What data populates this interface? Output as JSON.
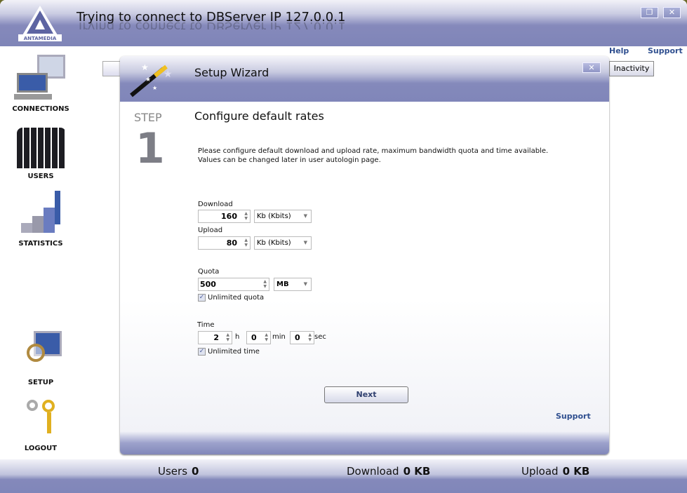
{
  "window": {
    "title": "Trying to connect to DBServer IP 127.0.0.1",
    "logo_text": "ANTAMEDIA",
    "restore_icon": "restore-icon",
    "close_icon": "close-icon"
  },
  "top_links": {
    "help": "Help",
    "support": "Support"
  },
  "sidebar": {
    "items": [
      {
        "label": "CONNECTIONS",
        "icon": "computer-icon"
      },
      {
        "label": "USERS",
        "icon": "users-icon"
      },
      {
        "label": "STATISTICS",
        "icon": "chart-icon"
      },
      {
        "label": "SETUP",
        "icon": "setup-icon"
      },
      {
        "label": "LOGOUT",
        "icon": "keys-icon"
      }
    ]
  },
  "background_tab": {
    "label": "Inactivity"
  },
  "wizard": {
    "title": "Setup Wizard",
    "step_label": "STEP",
    "step_number": "1",
    "heading": "Configure default rates",
    "description_line1": "Please configure default download and upload rate, maximum bandwidth quota  and time available.",
    "description_line2": "Values can be changed later in user autologin page.",
    "download": {
      "label": "Download",
      "value": "160",
      "unit": "Kb (Kbits)"
    },
    "upload": {
      "label": "Upload",
      "value": "80",
      "unit": "Kb (Kbits)"
    },
    "quota": {
      "label": "Quota",
      "value": "500",
      "unit": "MB",
      "unlimited_label": "Unlimited quota",
      "unlimited_checked": true
    },
    "time": {
      "label": "Time",
      "hours": "2",
      "h": "h",
      "minutes": "0",
      "min": "min",
      "seconds": "0",
      "sec": "sec",
      "unlimited_label": "Unlimited time",
      "unlimited_checked": true
    },
    "next": "Next",
    "support": "Support",
    "check": "✓"
  },
  "status": {
    "users_label": "Users",
    "users_value": "0",
    "download_label": "Download",
    "download_value": "0 KB",
    "upload_label": "Upload",
    "upload_value": "0 KB"
  },
  "colors": {
    "band": "#8086b9",
    "link": "#2f4f8f"
  }
}
